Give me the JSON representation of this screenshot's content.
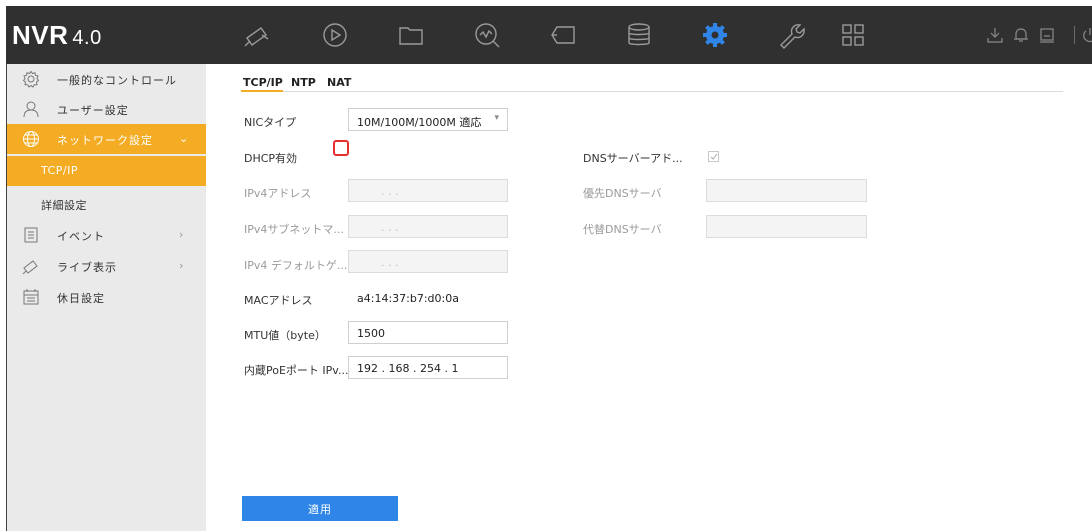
{
  "header": {
    "logo_main": "NVR",
    "logo_version": "4.0",
    "modules": [
      {
        "name": "live-view",
        "icon": "camera-icon"
      },
      {
        "name": "playback",
        "icon": "playback-icon"
      },
      {
        "name": "file-management",
        "icon": "folder-icon"
      },
      {
        "name": "smart-analysis",
        "icon": "search-analysis-icon"
      },
      {
        "name": "smart-search",
        "icon": "ptz-icon"
      },
      {
        "name": "storage",
        "icon": "database-icon"
      },
      {
        "name": "configuration",
        "icon": "gear-icon",
        "active": true
      },
      {
        "name": "maintenance",
        "icon": "wrench-icon"
      },
      {
        "name": "grid",
        "icon": "grid-icon"
      }
    ],
    "utilities": [
      "download-icon",
      "bell-icon",
      "lock-icon",
      "power-icon"
    ],
    "active_color": "#2f86e8"
  },
  "sidebar": {
    "items": [
      {
        "label": "一般的なコントロール",
        "icon": "gear-outline-icon"
      },
      {
        "label": "ユーザー設定",
        "icon": "user-icon"
      },
      {
        "label": "ネットワーク設定",
        "icon": "globe-icon",
        "expanded": true
      },
      {
        "label": "イベント",
        "icon": "event-icon"
      },
      {
        "label": "ライブ表示",
        "icon": "camera-icon"
      },
      {
        "label": "休日設定",
        "icon": "calendar-icon"
      }
    ],
    "sub_items": [
      {
        "label": "TCP/IP",
        "selected": true
      },
      {
        "label": "詳細設定"
      }
    ],
    "accent_color": "#f3ac24"
  },
  "tabs": [
    {
      "label": "TCP/IP",
      "active": true
    },
    {
      "label": "NTP"
    },
    {
      "label": "NAT"
    }
  ],
  "form": {
    "nic_type": {
      "label": "NICタイプ",
      "value": "10M/100M/1000M 適応"
    },
    "dhcp": {
      "label": "DHCP有効",
      "checked": false
    },
    "ipv4_address": {
      "label": "IPv4アドレス",
      "value": ".        .        ."
    },
    "ipv4_subnet": {
      "label": "IPv4サブネットマ...",
      "value": ".        .        ."
    },
    "ipv4_gateway": {
      "label": "IPv4 デフォルトゲ...",
      "value": ".        .        ."
    },
    "mac": {
      "label": "MACアドレス",
      "value": "a4:14:37:b7:d0:0a"
    },
    "mtu": {
      "label": "MTU値（byte）",
      "value": "1500"
    },
    "poe_ip": {
      "label": "内蔵PoEポート IPv...",
      "value": "192  . 168   . 254   . 1"
    },
    "dns_auto": {
      "label": "DNSサーバーアド...",
      "checked": true
    },
    "preferred_dns": {
      "label": "優先DNSサーバ",
      "value": ""
    },
    "alternate_dns": {
      "label": "代替DNSサーバ",
      "value": ""
    }
  },
  "apply_label": "適用"
}
